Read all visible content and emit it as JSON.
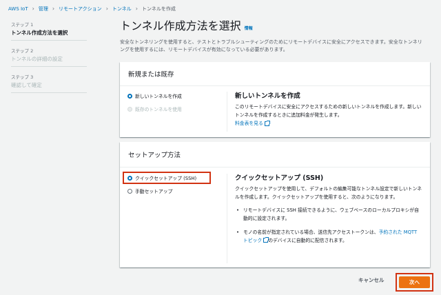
{
  "breadcrumb": [
    {
      "label": "AWS IoT"
    },
    {
      "label": "管理"
    },
    {
      "label": "リモートアクション"
    },
    {
      "label": "トンネル"
    },
    {
      "label": "トンネルを作成"
    }
  ],
  "wizard": {
    "steps": [
      {
        "number": "ステップ 1",
        "title": "トンネル作成方法を選択"
      },
      {
        "number": "ステップ 2",
        "title": "トンネルの詳細の設定"
      },
      {
        "number": "ステップ 3",
        "title": "確認して確定"
      }
    ]
  },
  "main": {
    "title": "トンネル作成方法を選択",
    "info_link": "情報",
    "description": "安全なトンネリングを使用すると、テストとトラブルシューティングのためにリモートデバイスに安全にアクセスできます。安全なトンネリングを使用するには、リモートデバイスが有効になっている必要があります。"
  },
  "panel1": {
    "header": "新規または既存",
    "options": [
      {
        "label": "新しいトンネルを作成",
        "selected": true,
        "disabled": false
      },
      {
        "label": "既存のトンネルを使用",
        "selected": false,
        "disabled": true
      }
    ],
    "detail_title": "新しいトンネルを作成",
    "detail_text": "このリモートデバイスに安全にアクセスするための新しいトンネルを作成します。新しいトンネルを作成するときに追加料金が発生します。",
    "pricing_link": "料金表を見る"
  },
  "panel2": {
    "header": "セットアップ方法",
    "options": [
      {
        "label": "クイックセットアップ (SSH)",
        "selected": true
      },
      {
        "label": "手動セットアップ",
        "selected": false
      }
    ],
    "detail_title": "クイックセットアップ (SSH)",
    "detail_text": "クイックセットアップを使用して、デフォルトの編集可能なトンネル設定で新しいトンネルを作成します。クイックセットアップを使用すると、次のようになります。",
    "bullet1": "リモートデバイスに SSH 接続できるように、ウェブベースのローカルプロキシが自動的に設定されます。",
    "bullet2_pre": "モノの名前が指定されている場合、送信先アクセストークンは、",
    "bullet2_link": "予約された MQTT トピック",
    "bullet2_post": "のデバイスに自動的に配信されます。"
  },
  "footer": {
    "cancel_label": "キャンセル",
    "next_label": "次へ"
  },
  "colors": {
    "link": "#0073bb",
    "primary_button": "#ec7211",
    "highlight": "#d13212"
  }
}
